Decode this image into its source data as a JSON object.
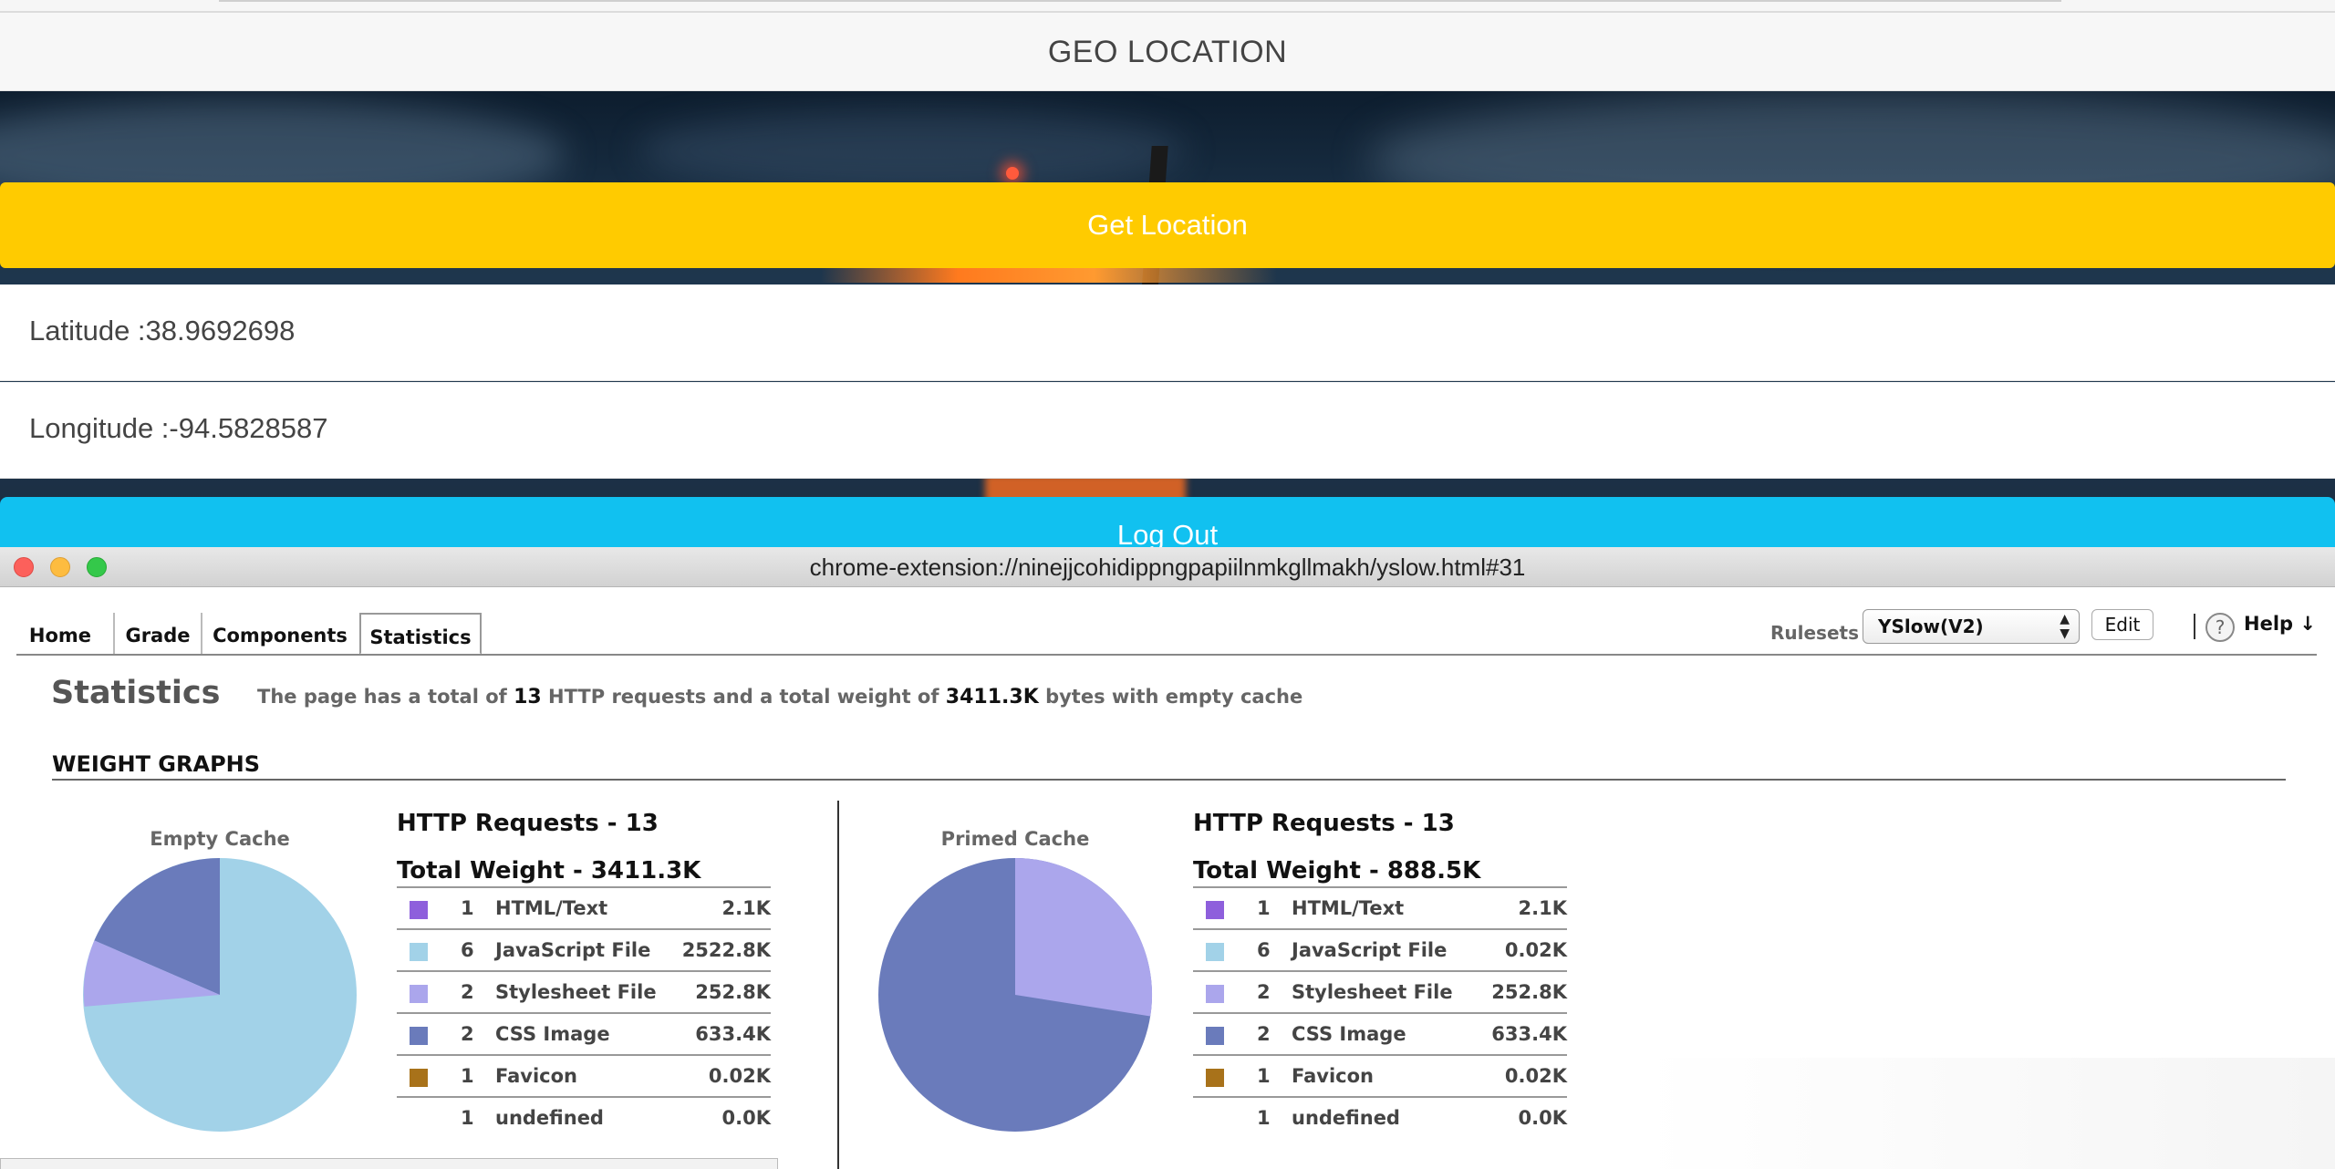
{
  "page": {
    "title": "GEO LOCATION",
    "get_location_button": "Get Location",
    "latitude_text": "Latitude :38.9692698",
    "longitude_text": "Longitude :-94.5828587",
    "logout_button": "Log Out",
    "colors": {
      "get_location": "#ffcb00",
      "logout": "#11c1f0"
    }
  },
  "yslow": {
    "window_url": "chrome-extension://ninejjcohidippngpapiilnmkgllmakh/yslow.html#31",
    "tabs": [
      {
        "label": "Home"
      },
      {
        "label": "Grade"
      },
      {
        "label": "Components"
      },
      {
        "label": "Statistics",
        "active": true
      }
    ],
    "rulesets_label": "Rulesets",
    "ruleset_selected": "YSlow(V2)",
    "edit_button": "Edit",
    "help_icon_glyph": "?",
    "help_label": "Help ↓",
    "statistics_title": "Statistics",
    "summary": {
      "prefix": "The page has a total of",
      "requests": "13",
      "middle": "HTTP requests and a total weight of",
      "weight": "3411.3K",
      "suffix": "bytes with empty cache"
    },
    "weight_graphs_title": "WEIGHT GRAPHS",
    "empty_cache": {
      "label": "Empty Cache",
      "requests_heading": "HTTP Requests - 13",
      "weight_heading": "Total Weight - 3411.3K",
      "rows": [
        {
          "count": "1",
          "type": "HTML/Text",
          "size": "2.1K",
          "color": "#8e5fdc"
        },
        {
          "count": "6",
          "type": "JavaScript File",
          "size": "2522.8K",
          "color": "#a2d2e8"
        },
        {
          "count": "2",
          "type": "Stylesheet File",
          "size": "252.8K",
          "color": "#aba6ec"
        },
        {
          "count": "2",
          "type": "CSS Image",
          "size": "633.4K",
          "color": "#6a7bbb"
        },
        {
          "count": "1",
          "type": "Favicon",
          "size": "0.02K",
          "color": "#a8721a"
        },
        {
          "count": "1",
          "type": "undefined",
          "size": "0.0K",
          "color": ""
        }
      ]
    },
    "primed_cache": {
      "label": "Primed Cache",
      "requests_heading": "HTTP Requests - 13",
      "weight_heading": "Total Weight - 888.5K",
      "rows": [
        {
          "count": "1",
          "type": "HTML/Text",
          "size": "2.1K",
          "color": "#8e5fdc"
        },
        {
          "count": "6",
          "type": "JavaScript File",
          "size": "0.02K",
          "color": "#a2d2e8"
        },
        {
          "count": "2",
          "type": "Stylesheet File",
          "size": "252.8K",
          "color": "#aba6ec"
        },
        {
          "count": "2",
          "type": "CSS Image",
          "size": "633.4K",
          "color": "#6a7bbb"
        },
        {
          "count": "1",
          "type": "Favicon",
          "size": "0.02K",
          "color": "#a8721a"
        },
        {
          "count": "1",
          "type": "undefined",
          "size": "0.0K",
          "color": ""
        }
      ]
    }
  }
}
